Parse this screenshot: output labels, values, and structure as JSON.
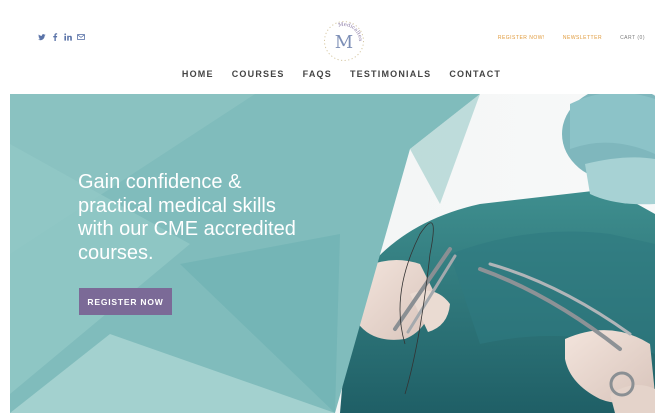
{
  "social": {
    "icons": [
      "twitter-icon",
      "facebook-icon",
      "linkedin-icon",
      "email-icon"
    ],
    "color": "#5a73a8"
  },
  "logo": {
    "letter": "M",
    "arc_text": "Medicaltea"
  },
  "top_links": {
    "register": "REGISTER NOW!",
    "newsletter": "NEWSLETTER",
    "cart": "CART (0)"
  },
  "nav": {
    "home": "HOME",
    "courses": "COURSES",
    "faqs": "FAQS",
    "testimonials": "TESTIMONIALS",
    "contact": "CONTACT"
  },
  "hero": {
    "line1": "Gain confidence &",
    "line2": "practical medical skills",
    "line3": "with our CME accredited",
    "line4": "courses.",
    "cta": "REGISTER NOW"
  },
  "colors": {
    "accent_orange": "#e09a3b",
    "cta_purple": "#7b6a97",
    "teal": "#7fbcbb"
  }
}
